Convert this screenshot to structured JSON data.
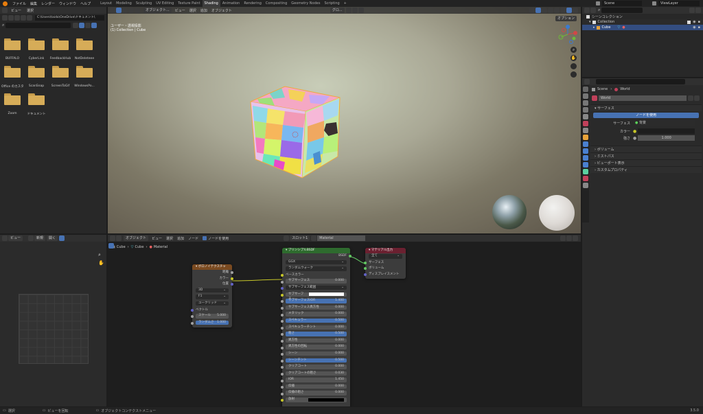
{
  "menubar": {
    "items": [
      "ファイル",
      "編集",
      "レンダー",
      "ウィンドウ",
      "ヘルプ"
    ]
  },
  "workspaces": {
    "tabs": [
      "Layout",
      "Modeling",
      "Sculpting",
      "UV Editing",
      "Texture Paint",
      "Shading",
      "Animation",
      "Rendering",
      "Compositing",
      "Geometry Nodes",
      "Scripting",
      "+"
    ],
    "active": "Shading"
  },
  "scene": {
    "name": "Scene",
    "view_layer": "ViewLayer"
  },
  "filebrowser": {
    "menu": [
      "ビュー",
      "選択"
    ],
    "path": "C:\\Users\\taido\\OneDrive\\ドキュメント\\",
    "files": [
      "BUFFALO",
      "CyberLink",
      "FeedbackHub",
      "NotDeleteee",
      "Office のカスタム...",
      "ScanSnap",
      "ScreenToGif",
      "WindowsPo...",
      "Zoom",
      "ドキュメント"
    ]
  },
  "viewport": {
    "mode": "オブジェクト...",
    "menu": [
      "ビュー",
      "選択",
      "追加",
      "オブジェクト"
    ],
    "transform": "グロ...",
    "overlay_label": "ユーザー・透視投影",
    "collection_label": "(1) Collection | Cube",
    "options": "オプション"
  },
  "outliner": {
    "title": "シーンコレクション",
    "collection": "Collection",
    "object": "Cube"
  },
  "properties": {
    "breadcrumb_scene": "Scene",
    "breadcrumb_world": "World",
    "world_name": "World",
    "surface_header": "サーフェス",
    "use_nodes": "ノードを使用",
    "surface_label": "サーフェス",
    "surface_value": "背景",
    "color_label": "カラー",
    "strength_label": "強さ",
    "strength_value": "1.000",
    "sections": [
      "ボリューム",
      "ミストパス",
      "ビューポート表示",
      "カスタムプロパティ"
    ]
  },
  "imagebrowser": {
    "view": "ビュー",
    "new": "新規",
    "open": "開く"
  },
  "nodeeditor": {
    "mode": "オブジェクト",
    "menu": [
      "ビュー",
      "選択",
      "追加",
      "ノード"
    ],
    "use_nodes": "ノードを使用",
    "slot": "スロット1",
    "material": "Material",
    "breadcrumb": [
      "Cube",
      "Cube",
      "Material"
    ]
  },
  "voronoi": {
    "title": "ボロノイテクスチャ",
    "outputs": [
      "距離",
      "カラー",
      "位置"
    ],
    "dim": "3D",
    "feature": "F1",
    "metric": "ユークリッド",
    "vector": "ベクトル",
    "scale_label": "スケール",
    "scale_value": "5.000",
    "rand_label": "ランダムさ",
    "rand_value": "1.000"
  },
  "bsdf": {
    "title": "プリンシプルBSDF",
    "output": "BSDF",
    "distribution": "GGX",
    "sss_method": "ランダムウォーク",
    "base_color": "ベースカラー",
    "rows": [
      {
        "label": "サブサーフェス",
        "value": "0.000"
      },
      {
        "label": "サブサーフェス範囲",
        "value": ""
      },
      {
        "label": "サブサーフェ...",
        "value": ""
      },
      {
        "label": "サブサーフェスIOR",
        "value": "1.400"
      },
      {
        "label": "サブサーフェス異方性",
        "value": "0.000"
      },
      {
        "label": "メタリック",
        "value": "0.000"
      },
      {
        "label": "スペキュラー",
        "value": "0.500"
      },
      {
        "label": "スペキュラーチント",
        "value": "0.000"
      },
      {
        "label": "粗さ",
        "value": "0.500"
      },
      {
        "label": "異方性",
        "value": "0.000"
      },
      {
        "label": "異方性の回転",
        "value": "0.000"
      },
      {
        "label": "シーン",
        "value": "0.000"
      },
      {
        "label": "シーンチント",
        "value": "0.500"
      },
      {
        "label": "クリアコート",
        "value": "0.000"
      },
      {
        "label": "クリアコートの粗さ",
        "value": "0.030"
      },
      {
        "label": "IOR",
        "value": "1.450"
      },
      {
        "label": "伝播",
        "value": "0.000"
      },
      {
        "label": "伝播の粗さ",
        "value": "0.000"
      },
      {
        "label": "放射",
        "value": ""
      }
    ]
  },
  "matoutput": {
    "title": "マテリアル出力",
    "target": "全て",
    "inputs": [
      "サーフェス",
      "ボリューム",
      "ディスプレイスメント"
    ]
  },
  "statusbar": {
    "select": "選択",
    "rotate": "ビューを回転",
    "context": "オブジェクトコンテクストメニュー",
    "version": "3.5.0"
  },
  "colors": {
    "accent": "#4772b3",
    "voronoi_header": "#7a4a20",
    "bsdf_header": "#2e6b2e",
    "output_header": "#6b2030",
    "socket_yellow": "#c7c729",
    "socket_purple": "#6363c7",
    "socket_green": "#63c763",
    "socket_grey": "#a1a1a1"
  }
}
